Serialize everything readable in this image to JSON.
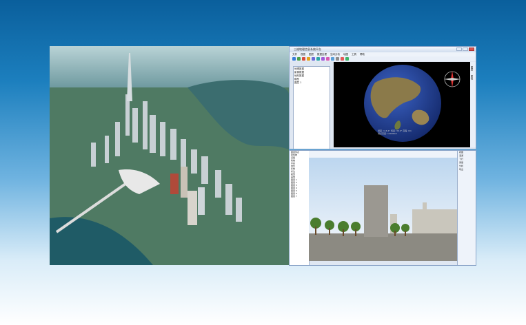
{
  "aerial": {
    "icon": "city-aerial-render"
  },
  "window_globe": {
    "title": "三维地理信息系统平台",
    "menu": [
      "文件",
      "视图",
      "图层",
      "数据处理",
      "空间分析",
      "地图",
      "工具",
      "帮助"
    ],
    "tree": [
      "地理数据",
      "影像数据",
      "地形数据",
      "模型",
      "图层 1"
    ],
    "sidebar": [
      "图层",
      "属性"
    ],
    "status_lines": [
      "经度: 116.4°  纬度: 39.9°  高程: 0m",
      "视点高度: 12000km"
    ]
  },
  "window_scene": {
    "panel_items": [
      "图层列表",
      "建筑物",
      "道路",
      "植被",
      "水系",
      "地形",
      "影像",
      "标注",
      "模型",
      "其他",
      "图层 1",
      "图层 2",
      "图层 3",
      "图层 4",
      "图层 5",
      "图层 6",
      "图层 7"
    ],
    "right_items": [
      "视图",
      "漫游",
      "飞行",
      "测量",
      "分析",
      "导出"
    ]
  },
  "colors": {
    "accent": "#0a5f9c",
    "ocean": "#1d3c8e",
    "land": "#8b7a4a"
  }
}
